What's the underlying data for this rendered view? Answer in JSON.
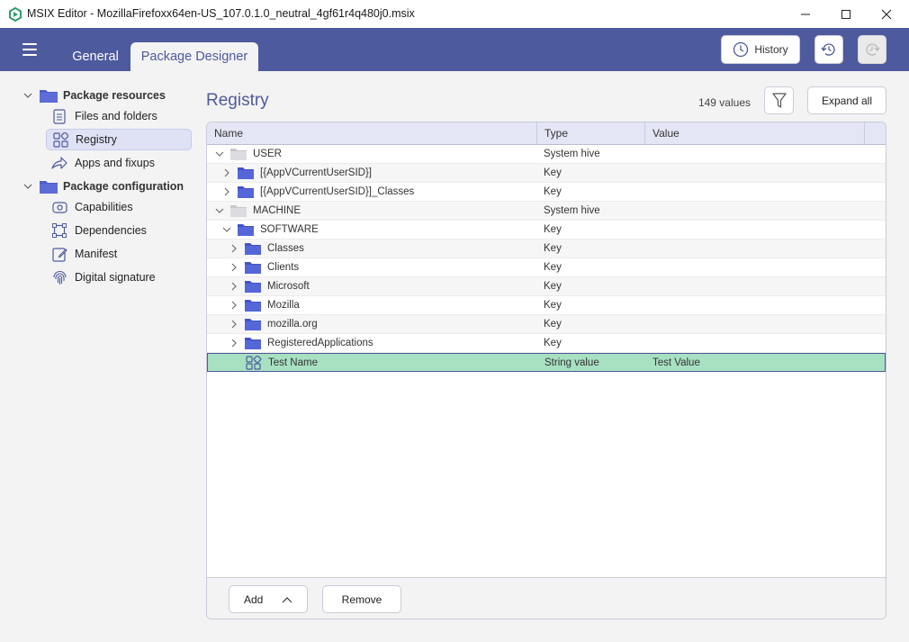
{
  "window": {
    "title": "MSIX Editor - MozillaFirefoxx64en-US_107.0.1.0_neutral_4gf61r4q480j0.msix",
    "controls": [
      "minimize-icon",
      "maximize-icon",
      "close-icon"
    ]
  },
  "header": {
    "tabs": [
      {
        "label": "General",
        "active": false
      },
      {
        "label": "Package Designer",
        "active": true
      }
    ],
    "history_label": "History",
    "accent": "#4e5a9e"
  },
  "sidebar": {
    "groups": [
      {
        "label": "Package resources",
        "items": [
          {
            "label": "Files and folders",
            "icon": "document-icon"
          },
          {
            "label": "Registry",
            "icon": "registry-icon",
            "selected": true
          },
          {
            "label": "Apps and fixups",
            "icon": "share-icon"
          }
        ]
      },
      {
        "label": "Package configuration",
        "items": [
          {
            "label": "Capabilities",
            "icon": "capabilities-icon"
          },
          {
            "label": "Dependencies",
            "icon": "dependencies-icon"
          },
          {
            "label": "Manifest",
            "icon": "edit-document-icon"
          },
          {
            "label": "Digital signature",
            "icon": "fingerprint-icon"
          }
        ]
      }
    ]
  },
  "main": {
    "title": "Registry",
    "count": "149 values",
    "expand_all_label": "Expand all",
    "columns": [
      "Name",
      "Type",
      "Value"
    ],
    "rows": [
      {
        "name": "USER",
        "type": "System hive",
        "value": "",
        "level": 0,
        "expanded": true,
        "icon": "hive-folder-icon"
      },
      {
        "name": "[{AppVCurrentUserSID}]",
        "type": "Key",
        "value": "",
        "level": 1,
        "expanded": false,
        "icon": "folder-icon"
      },
      {
        "name": "[{AppVCurrentUserSID}]_Classes",
        "type": "Key",
        "value": "",
        "level": 1,
        "expanded": false,
        "icon": "folder-icon"
      },
      {
        "name": "MACHINE",
        "type": "System hive",
        "value": "",
        "level": 0,
        "expanded": true,
        "icon": "hive-folder-icon"
      },
      {
        "name": "SOFTWARE",
        "type": "Key",
        "value": "",
        "level": 1,
        "expanded": true,
        "icon": "folder-icon"
      },
      {
        "name": "Classes",
        "type": "Key",
        "value": "",
        "level": 2,
        "expanded": false,
        "icon": "folder-icon"
      },
      {
        "name": "Clients",
        "type": "Key",
        "value": "",
        "level": 2,
        "expanded": false,
        "icon": "folder-icon"
      },
      {
        "name": "Microsoft",
        "type": "Key",
        "value": "",
        "level": 2,
        "expanded": false,
        "icon": "folder-icon"
      },
      {
        "name": "Mozilla",
        "type": "Key",
        "value": "",
        "level": 2,
        "expanded": false,
        "icon": "folder-icon"
      },
      {
        "name": "mozilla.org",
        "type": "Key",
        "value": "",
        "level": 2,
        "expanded": false,
        "icon": "folder-icon"
      },
      {
        "name": "RegisteredApplications",
        "type": "Key",
        "value": "",
        "level": 2,
        "expanded": false,
        "icon": "folder-icon"
      },
      {
        "name": "Test Name",
        "type": "String value",
        "value": "Test Value",
        "level": 2,
        "leaf": true,
        "selected": true,
        "icon": "registry-value-icon"
      }
    ],
    "footer": {
      "add_label": "Add",
      "remove_label": "Remove"
    }
  }
}
